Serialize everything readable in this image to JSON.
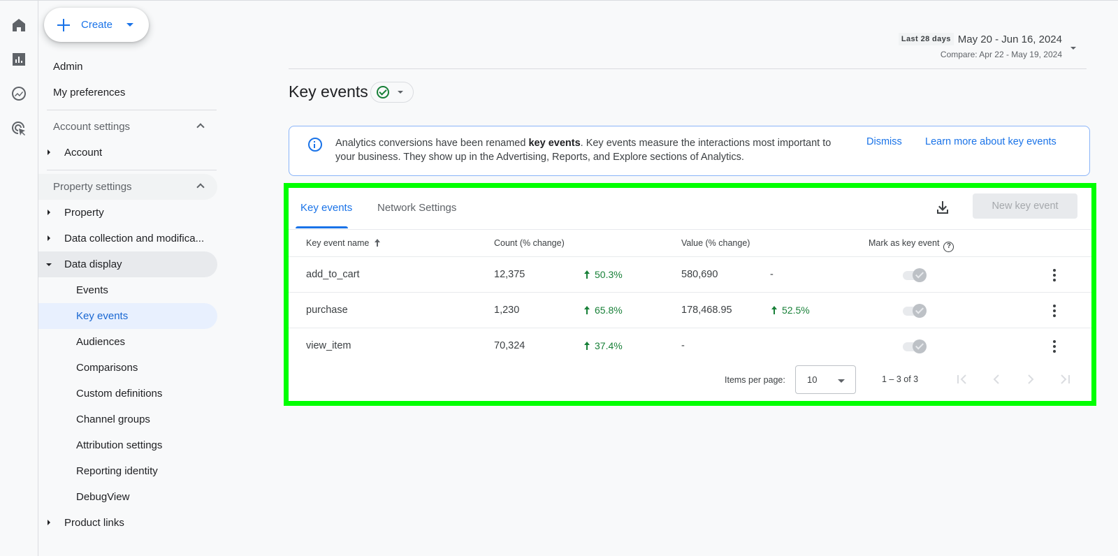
{
  "rail": {
    "icons": [
      "home-icon",
      "reports-icon",
      "explore-icon",
      "advertising-icon"
    ]
  },
  "nav": {
    "create_label": "Create",
    "admin": "Admin",
    "my_preferences": "My preferences",
    "account_settings": "Account settings",
    "account": "Account",
    "property_settings": "Property settings",
    "property": "Property",
    "data_collection": "Data collection and modifica...",
    "data_display": "Data display",
    "data_display_items": [
      "Events",
      "Key events",
      "Audiences",
      "Comparisons",
      "Custom definitions",
      "Channel groups",
      "Attribution settings",
      "Reporting identity",
      "DebugView"
    ],
    "product_links": "Product links",
    "selected": "Key events"
  },
  "date_range": {
    "preset": "Last 28 days",
    "range": "May 20 - Jun 16, 2024",
    "compare": "Compare: Apr 22 - May 19, 2024"
  },
  "page": {
    "title": "Key events",
    "status": "check-circle"
  },
  "banner": {
    "text_before": "Analytics conversions have been renamed ",
    "text_bold": "key events",
    "text_after": ". Key events measure the interactions most important to your business. They show up in the Advertising, Reports, and Explore sections of Analytics.",
    "dismiss": "Dismiss",
    "learn_more": "Learn more about key events"
  },
  "card": {
    "tabs": [
      {
        "label": "Key events",
        "active": true
      },
      {
        "label": "Network Settings",
        "active": false
      }
    ],
    "new_button": "New key event",
    "columns": {
      "name": "Key event name",
      "count": "Count (% change)",
      "value": "Value (% change)",
      "mark": "Mark as key event"
    },
    "rows": [
      {
        "name": "add_to_cart",
        "count": "12,375",
        "count_change": "50.3%",
        "value": "580,690",
        "value_change": "-",
        "marked": true
      },
      {
        "name": "purchase",
        "count": "1,230",
        "count_change": "65.8%",
        "value": "178,468.95",
        "value_change": "52.5%",
        "marked": true
      },
      {
        "name": "view_item",
        "count": "70,324",
        "count_change": "37.4%",
        "value": "-",
        "value_change": "",
        "marked": true
      }
    ],
    "pager": {
      "items_per_page_label": "Items per page:",
      "items_per_page": "10",
      "range": "1 – 3 of 3"
    }
  },
  "colors": {
    "accent": "#1a73e8",
    "positive": "#188038",
    "highlight_border": "#00ff00"
  }
}
